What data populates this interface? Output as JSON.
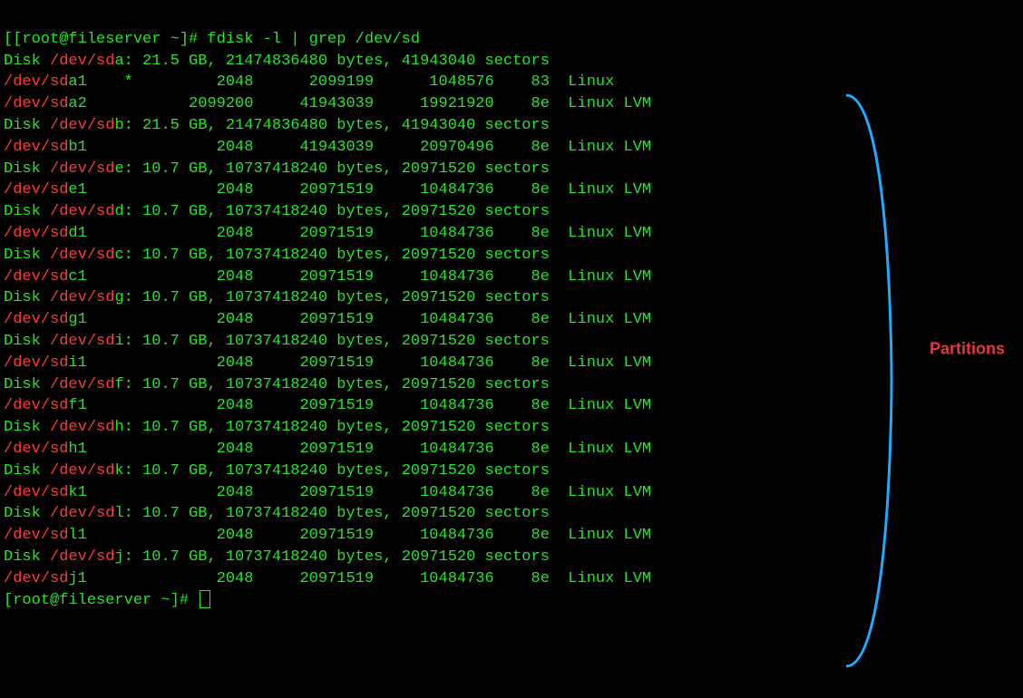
{
  "prompt_line": "[[root@fileserver ~]# fdisk -l | grep /dev/sd",
  "prompt_end": "[root@fileserver ~]# ",
  "annotation_label": "Partitions",
  "lines": [
    {
      "type": "disk",
      "dev_pre": "Disk ",
      "dev_hi": "/dev/sd",
      "dev_tail": "a: 21.5 GB, 21474836480 bytes, 41943040 sectors"
    },
    {
      "type": "part",
      "dev_hi": "/dev/sd",
      "dev_tail": "a1",
      "boot": "*",
      "start": "2048",
      "end": "2099199",
      "blocks": "1048576",
      "id": "83",
      "sys": "Linux"
    },
    {
      "type": "part",
      "dev_hi": "/dev/sd",
      "dev_tail": "a2",
      "boot": "",
      "start": "2099200",
      "end": "41943039",
      "blocks": "19921920",
      "id": "8e",
      "sys": "Linux LVM"
    },
    {
      "type": "disk",
      "dev_pre": "Disk ",
      "dev_hi": "/dev/sd",
      "dev_tail": "b: 21.5 GB, 21474836480 bytes, 41943040 sectors"
    },
    {
      "type": "part",
      "dev_hi": "/dev/sd",
      "dev_tail": "b1",
      "boot": "",
      "start": "2048",
      "end": "41943039",
      "blocks": "20970496",
      "id": "8e",
      "sys": "Linux LVM"
    },
    {
      "type": "disk",
      "dev_pre": "Disk ",
      "dev_hi": "/dev/sd",
      "dev_tail": "e: 10.7 GB, 10737418240 bytes, 20971520 sectors"
    },
    {
      "type": "part",
      "dev_hi": "/dev/sd",
      "dev_tail": "e1",
      "boot": "",
      "start": "2048",
      "end": "20971519",
      "blocks": "10484736",
      "id": "8e",
      "sys": "Linux LVM"
    },
    {
      "type": "disk",
      "dev_pre": "Disk ",
      "dev_hi": "/dev/sd",
      "dev_tail": "d: 10.7 GB, 10737418240 bytes, 20971520 sectors"
    },
    {
      "type": "part",
      "dev_hi": "/dev/sd",
      "dev_tail": "d1",
      "boot": "",
      "start": "2048",
      "end": "20971519",
      "blocks": "10484736",
      "id": "8e",
      "sys": "Linux LVM"
    },
    {
      "type": "disk",
      "dev_pre": "Disk ",
      "dev_hi": "/dev/sd",
      "dev_tail": "c: 10.7 GB, 10737418240 bytes, 20971520 sectors"
    },
    {
      "type": "part",
      "dev_hi": "/dev/sd",
      "dev_tail": "c1",
      "boot": "",
      "start": "2048",
      "end": "20971519",
      "blocks": "10484736",
      "id": "8e",
      "sys": "Linux LVM"
    },
    {
      "type": "disk",
      "dev_pre": "Disk ",
      "dev_hi": "/dev/sd",
      "dev_tail": "g: 10.7 GB, 10737418240 bytes, 20971520 sectors"
    },
    {
      "type": "part",
      "dev_hi": "/dev/sd",
      "dev_tail": "g1",
      "boot": "",
      "start": "2048",
      "end": "20971519",
      "blocks": "10484736",
      "id": "8e",
      "sys": "Linux LVM"
    },
    {
      "type": "disk",
      "dev_pre": "Disk ",
      "dev_hi": "/dev/sd",
      "dev_tail": "i: 10.7 GB, 10737418240 bytes, 20971520 sectors"
    },
    {
      "type": "part",
      "dev_hi": "/dev/sd",
      "dev_tail": "i1",
      "boot": "",
      "start": "2048",
      "end": "20971519",
      "blocks": "10484736",
      "id": "8e",
      "sys": "Linux LVM"
    },
    {
      "type": "disk",
      "dev_pre": "Disk ",
      "dev_hi": "/dev/sd",
      "dev_tail": "f: 10.7 GB, 10737418240 bytes, 20971520 sectors"
    },
    {
      "type": "part",
      "dev_hi": "/dev/sd",
      "dev_tail": "f1",
      "boot": "",
      "start": "2048",
      "end": "20971519",
      "blocks": "10484736",
      "id": "8e",
      "sys": "Linux LVM"
    },
    {
      "type": "disk",
      "dev_pre": "Disk ",
      "dev_hi": "/dev/sd",
      "dev_tail": "h: 10.7 GB, 10737418240 bytes, 20971520 sectors"
    },
    {
      "type": "part",
      "dev_hi": "/dev/sd",
      "dev_tail": "h1",
      "boot": "",
      "start": "2048",
      "end": "20971519",
      "blocks": "10484736",
      "id": "8e",
      "sys": "Linux LVM"
    },
    {
      "type": "disk",
      "dev_pre": "Disk ",
      "dev_hi": "/dev/sd",
      "dev_tail": "k: 10.7 GB, 10737418240 bytes, 20971520 sectors"
    },
    {
      "type": "part",
      "dev_hi": "/dev/sd",
      "dev_tail": "k1",
      "boot": "",
      "start": "2048",
      "end": "20971519",
      "blocks": "10484736",
      "id": "8e",
      "sys": "Linux LVM"
    },
    {
      "type": "disk",
      "dev_pre": "Disk ",
      "dev_hi": "/dev/sd",
      "dev_tail": "l: 10.7 GB, 10737418240 bytes, 20971520 sectors"
    },
    {
      "type": "part",
      "dev_hi": "/dev/sd",
      "dev_tail": "l1",
      "boot": "",
      "start": "2048",
      "end": "20971519",
      "blocks": "10484736",
      "id": "8e",
      "sys": "Linux LVM"
    },
    {
      "type": "disk",
      "dev_pre": "Disk ",
      "dev_hi": "/dev/sd",
      "dev_tail": "j: 10.7 GB, 10737418240 bytes, 20971520 sectors"
    },
    {
      "type": "part",
      "dev_hi": "/dev/sd",
      "dev_tail": "j1",
      "boot": "",
      "start": "2048",
      "end": "20971519",
      "blocks": "10484736",
      "id": "8e",
      "sys": "Linux LVM"
    }
  ]
}
